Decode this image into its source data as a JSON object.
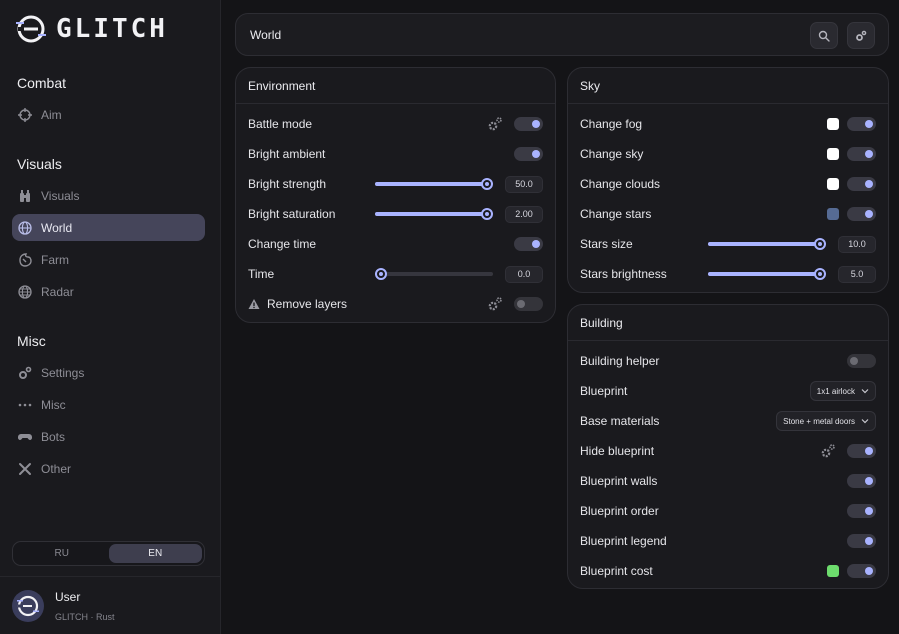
{
  "app": {
    "logo_text": "GLITCH"
  },
  "sidebar": {
    "sections": [
      {
        "title": "Combat",
        "items": [
          {
            "label": "Aim",
            "icon": "crosshair-icon"
          }
        ]
      },
      {
        "title": "Visuals",
        "items": [
          {
            "label": "Visuals",
            "icon": "binoculars-icon"
          },
          {
            "label": "World",
            "icon": "globe-icon",
            "active": true
          },
          {
            "label": "Farm",
            "icon": "leaf-icon"
          },
          {
            "label": "Radar",
            "icon": "radar-icon"
          }
        ]
      },
      {
        "title": "Misc",
        "items": [
          {
            "label": "Settings",
            "icon": "gears-icon"
          },
          {
            "label": "Misc",
            "icon": "ellipsis-icon"
          },
          {
            "label": "Bots",
            "icon": "gamepad-icon"
          },
          {
            "label": "Other",
            "icon": "tools-icon"
          }
        ]
      }
    ],
    "language": {
      "options": [
        "RU",
        "EN"
      ],
      "selected": "EN"
    },
    "user": {
      "name": "User",
      "subtitle": "GLITCH · Rust"
    }
  },
  "topbar": {
    "title": "World",
    "search_icon": "search-icon",
    "settings_icon": "gears-icon"
  },
  "colors": {
    "accent": "#a9b3ff",
    "stars_color": "#566b94",
    "cost_color": "#6ddc6d",
    "active_nav": "#45455a"
  },
  "environment": {
    "title": "Environment",
    "rows": [
      {
        "label": "Battle mode",
        "control": "toggle",
        "on": true,
        "gear": true
      },
      {
        "label": "Bright ambient",
        "control": "toggle",
        "on": true
      },
      {
        "label": "Bright strength",
        "control": "slider",
        "value": "50.0",
        "fill": 1.0
      },
      {
        "label": "Bright saturation",
        "control": "slider",
        "value": "2.00",
        "fill": 1.0
      },
      {
        "label": "Change time",
        "control": "toggle",
        "on": true
      },
      {
        "label": "Time",
        "control": "slider",
        "value": "0.0",
        "fill": 0.0
      },
      {
        "label": "Remove layers",
        "control": "toggle",
        "on": false,
        "gear": true,
        "warning": true
      }
    ]
  },
  "sky": {
    "title": "Sky",
    "rows": [
      {
        "label": "Change fog",
        "control": "toggle",
        "on": true,
        "swatch": "#ffffff"
      },
      {
        "label": "Change sky",
        "control": "toggle",
        "on": true,
        "swatch": "#ffffff"
      },
      {
        "label": "Change clouds",
        "control": "toggle",
        "on": true,
        "swatch": "#ffffff"
      },
      {
        "label": "Change stars",
        "control": "toggle",
        "on": true,
        "swatch": "#566b94"
      },
      {
        "label": "Stars size",
        "control": "slider",
        "value": "10.0",
        "fill": 1.0
      },
      {
        "label": "Stars brightness",
        "control": "slider",
        "value": "5.0",
        "fill": 1.0
      }
    ]
  },
  "building": {
    "title": "Building",
    "rows": [
      {
        "label": "Building helper",
        "control": "toggle",
        "on": false
      },
      {
        "label": "Blueprint",
        "control": "select",
        "value": "1x1 airlock"
      },
      {
        "label": "Base materials",
        "control": "select",
        "value": "Stone + metal doors"
      },
      {
        "label": "Hide blueprint",
        "control": "toggle",
        "on": true,
        "gear": true
      },
      {
        "label": "Blueprint walls",
        "control": "toggle",
        "on": true
      },
      {
        "label": "Blueprint order",
        "control": "toggle",
        "on": true
      },
      {
        "label": "Blueprint legend",
        "control": "toggle",
        "on": true
      },
      {
        "label": "Blueprint cost",
        "control": "toggle",
        "on": true,
        "swatch": "#6ddc6d"
      }
    ]
  }
}
